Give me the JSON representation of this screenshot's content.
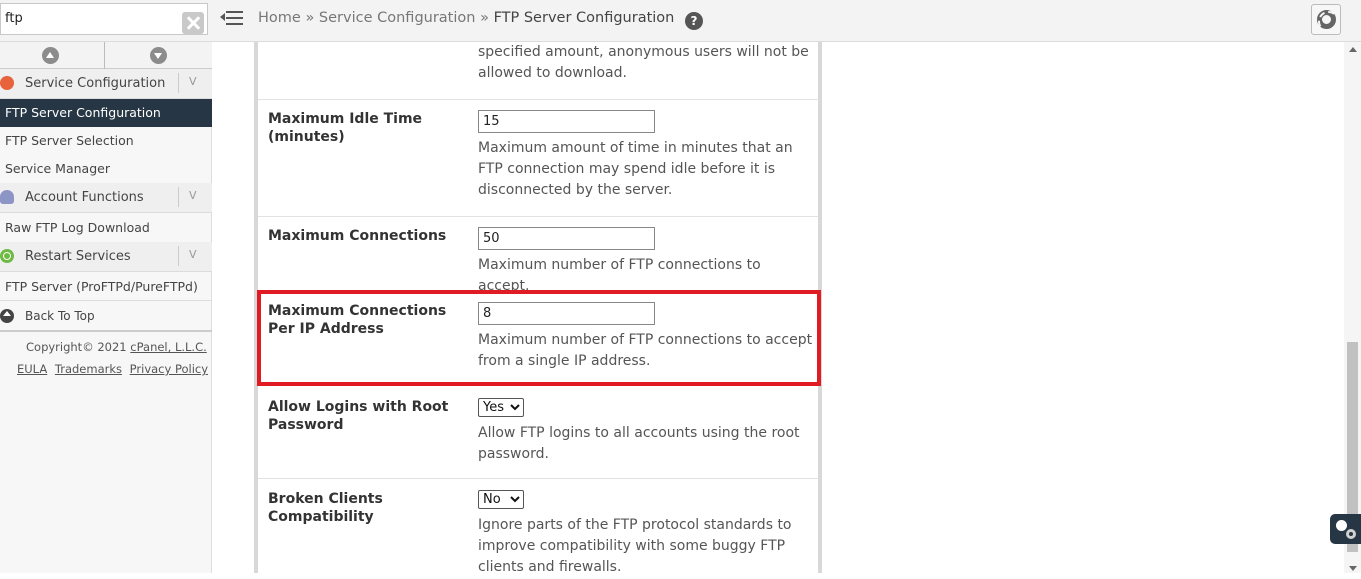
{
  "search": {
    "value": "ftp"
  },
  "breadcrumb": {
    "home": "Home",
    "sep1": "»",
    "section": "Service Configuration",
    "sep2": "»",
    "current": "FTP Server Configuration",
    "help": "?"
  },
  "sidebar": {
    "groups": [
      {
        "label": "Service Configuration",
        "icon": "wrench-icon",
        "items": [
          {
            "label": "FTP Server Configuration",
            "active": true
          },
          {
            "label": "FTP Server Selection"
          },
          {
            "label": "Service Manager"
          }
        ]
      },
      {
        "label": "Account Functions",
        "icon": "user-icon",
        "items": [
          {
            "label": "Raw FTP Log Download"
          }
        ]
      },
      {
        "label": "Restart Services",
        "icon": "restart-icon",
        "items": [
          {
            "label": "FTP Server (ProFTPd/PureFTPd)"
          }
        ]
      }
    ],
    "chevron": "V",
    "back_to_top": "Back To Top",
    "footer": {
      "copyright": "Copyright© 2021",
      "company": "cPanel, L.L.C.",
      "eula": "EULA",
      "trademarks": "Trademarks",
      "privacy": "Privacy Policy"
    }
  },
  "settings": {
    "top_desc": "specified amount, anonymous users will not be allowed to download.",
    "idle": {
      "label": "Maximum Idle Time (minutes)",
      "value": "15",
      "desc": "Maximum amount of time in minutes that an FTP connection may spend idle before it is disconnected by the server."
    },
    "max_conn": {
      "label": "Maximum Connections",
      "value": "50",
      "desc": "Maximum number of FTP connections to accept."
    },
    "max_conn_ip": {
      "label": "Maximum Connections Per IP Address",
      "value": "8",
      "desc": "Maximum number of FTP connections to accept from a single IP address."
    },
    "root_login": {
      "label": "Allow Logins with Root Password",
      "selected": "Yes",
      "desc": "Allow FTP logins to all accounts using the root password."
    },
    "broken_clients": {
      "label": "Broken Clients Compatibility",
      "selected": "No",
      "desc": "Ignore parts of the FTP protocol standards to improve compatibility with some buggy FTP clients and firewalls."
    }
  },
  "colors": {
    "highlight": "#e01b24",
    "active_nav": "#263645"
  }
}
